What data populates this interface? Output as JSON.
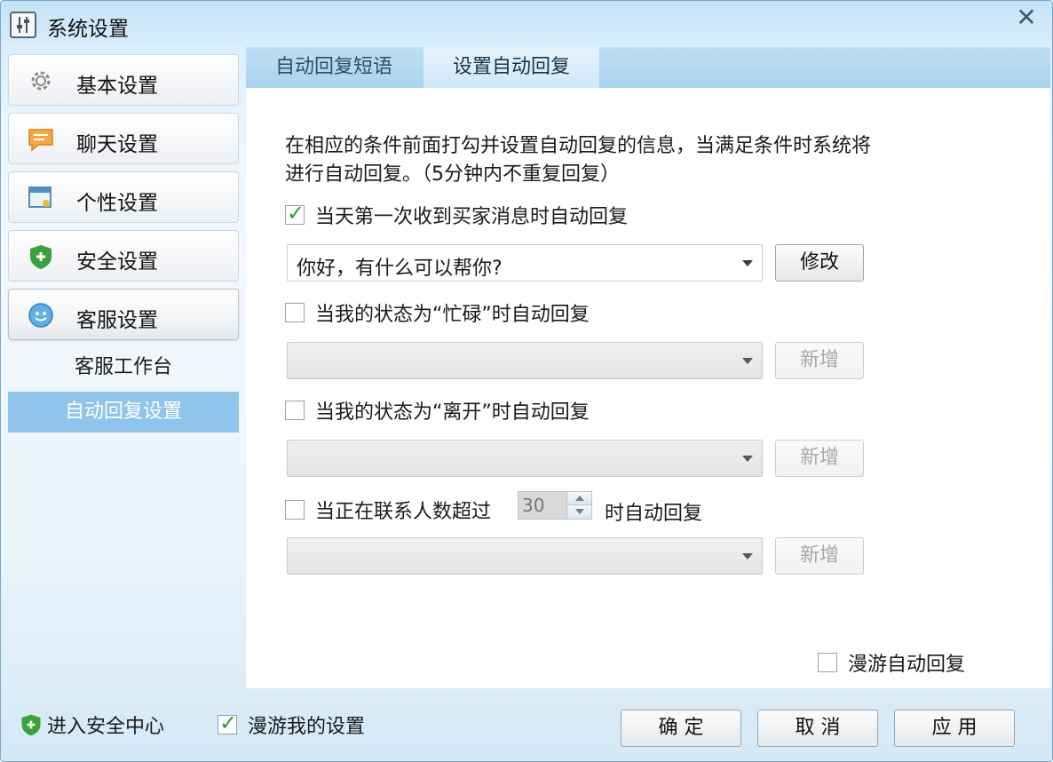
{
  "window": {
    "title": "系统设置",
    "close_glyph": "✕"
  },
  "sidebar": {
    "items": [
      {
        "label": "基本设置",
        "icon": "gear-icon"
      },
      {
        "label": "聊天设置",
        "icon": "chat-bubble-icon"
      },
      {
        "label": "个性设置",
        "icon": "window-skin-icon"
      },
      {
        "label": "安全设置",
        "icon": "shield-plus-icon"
      },
      {
        "label": "客服设置",
        "icon": "customer-service-icon"
      }
    ],
    "sub_items": [
      {
        "label": "客服工作台"
      },
      {
        "label": "自动回复设置",
        "selected": true
      }
    ]
  },
  "tabs": [
    {
      "label": "自动回复短语"
    },
    {
      "label": "设置自动回复",
      "active": true
    }
  ],
  "description": {
    "line1": "在相应的条件前面打勾并设置自动回复的信息，当满足条件时系统将",
    "line2": "进行自动回复。（5分钟内不重复回复）"
  },
  "rules": [
    {
      "label": "当天第一次收到买家消息时自动回复",
      "checked": true,
      "reply": "你好，有什么可以帮你?",
      "button": "修改",
      "enabled": true
    },
    {
      "label": "当我的状态为“忙碌”时自动回复",
      "checked": false,
      "reply": "",
      "button": "新增",
      "enabled": false
    },
    {
      "label": "当我的状态为“离开”时自动回复",
      "checked": false,
      "reply": "",
      "button": "新增",
      "enabled": false
    },
    {
      "label_prefix": "当正在联系人数超过",
      "count": "30",
      "label_suffix": "时自动回复",
      "checked": false,
      "reply": "",
      "button": "新增",
      "enabled": false
    }
  ],
  "roaming_reply": {
    "label": "漫游自动回复",
    "checked": false
  },
  "footer": {
    "security_center": "进入安全中心",
    "roam_settings": {
      "label": "漫游我的设置",
      "checked": true
    },
    "buttons": {
      "ok": "确 定",
      "cancel": "取 消",
      "apply": "应 用"
    }
  },
  "colors": {
    "accent": "#8fc5ea",
    "tab_bar": "#a9d3ee",
    "check_green": "#2f9d2f",
    "shield_green": "#3aa23a"
  }
}
